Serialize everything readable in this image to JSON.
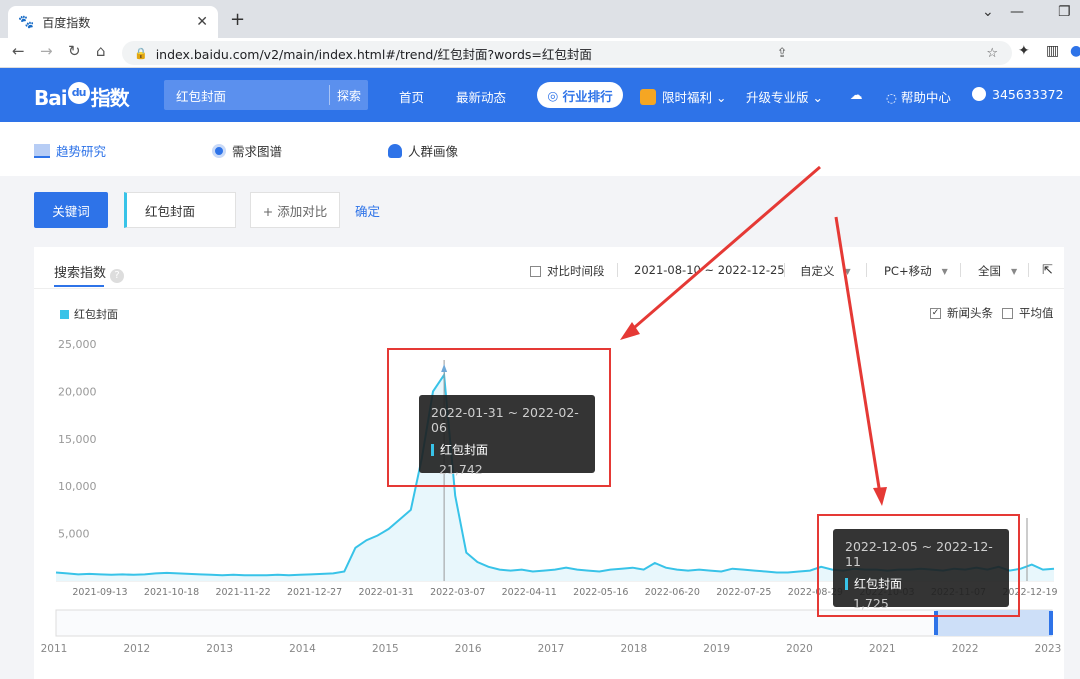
{
  "browser": {
    "tab_title": "百度指数",
    "url": "index.baidu.com/v2/main/index.html#/trend/红包封面?words=红包封面"
  },
  "appbar": {
    "logo_text": "Bai",
    "logo_suffix": "指数",
    "search_value": "红包封面",
    "search_button": "探索",
    "nav": [
      "首页",
      "最新动态",
      "行业排行",
      "限时福利",
      "升级专业版",
      "帮助中心"
    ],
    "user": "345633372"
  },
  "subtabs": [
    "趋势研究",
    "需求图谱",
    "人群画像"
  ],
  "toolbar": {
    "keyword_button": "关键词",
    "keyword_value": "红包封面",
    "add_compare": "+ 添加对比",
    "confirm": "确定"
  },
  "panel": {
    "title": "搜索指数",
    "compare_period": "对比时间段",
    "date_range": "2021-08-10 ~ 2022-12-25",
    "custom": "自定义",
    "device": "PC+移动",
    "region": "全国",
    "news": "新闻头条",
    "average": "平均值",
    "legend": "红包封面"
  },
  "chart_data": {
    "type": "area",
    "series": [
      {
        "name": "红包封面",
        "color": "#38c3e8"
      }
    ],
    "x_ticks": [
      "2021-09-13",
      "2021-10-18",
      "2021-11-22",
      "2021-12-27",
      "2022-01-31",
      "2022-03-07",
      "2022-04-11",
      "2022-05-16",
      "2022-06-20",
      "2022-07-25",
      "2022-08-29",
      "2022-10-03",
      "2022-11-07",
      "2022-12-19"
    ],
    "y_ticks": [
      "25,000",
      "20,000",
      "15,000",
      "10,000",
      "5,000"
    ],
    "ylim": [
      0,
      25000
    ],
    "weekly_values": [
      900,
      800,
      700,
      750,
      700,
      650,
      700,
      650,
      700,
      800,
      850,
      800,
      750,
      700,
      650,
      600,
      650,
      600,
      600,
      600,
      650,
      600,
      650,
      700,
      750,
      800,
      1000,
      3500,
      4300,
      4800,
      5500,
      6500,
      7500,
      13000,
      20000,
      21742,
      9000,
      3000,
      2000,
      1500,
      1200,
      1100,
      1200,
      1000,
      1100,
      1200,
      1400,
      1200,
      1100,
      1000,
      1200,
      1300,
      1400,
      1200,
      1900,
      1400,
      1200,
      1100,
      1200,
      1100,
      1000,
      1300,
      1200,
      1100,
      1000,
      900,
      900,
      1000,
      1100,
      1500,
      1200,
      1100,
      1300,
      1200,
      1200,
      1100,
      1200,
      1200,
      1300,
      1200,
      1100,
      1300,
      1200,
      1400,
      1200,
      1500,
      1100,
      1300,
      1725,
      1200,
      1300
    ],
    "tooltips": [
      {
        "range": "2022-01-31 ~ 2022-02-06",
        "name": "红包封面",
        "value": "21,742"
      },
      {
        "range": "2022-12-05 ~ 2022-12-11",
        "name": "红包封面",
        "value": "1,725"
      }
    ],
    "timeline_years": [
      "2011",
      "2012",
      "2013",
      "2014",
      "2015",
      "2016",
      "2017",
      "2018",
      "2019",
      "2020",
      "2021",
      "2022",
      "2023"
    ]
  }
}
